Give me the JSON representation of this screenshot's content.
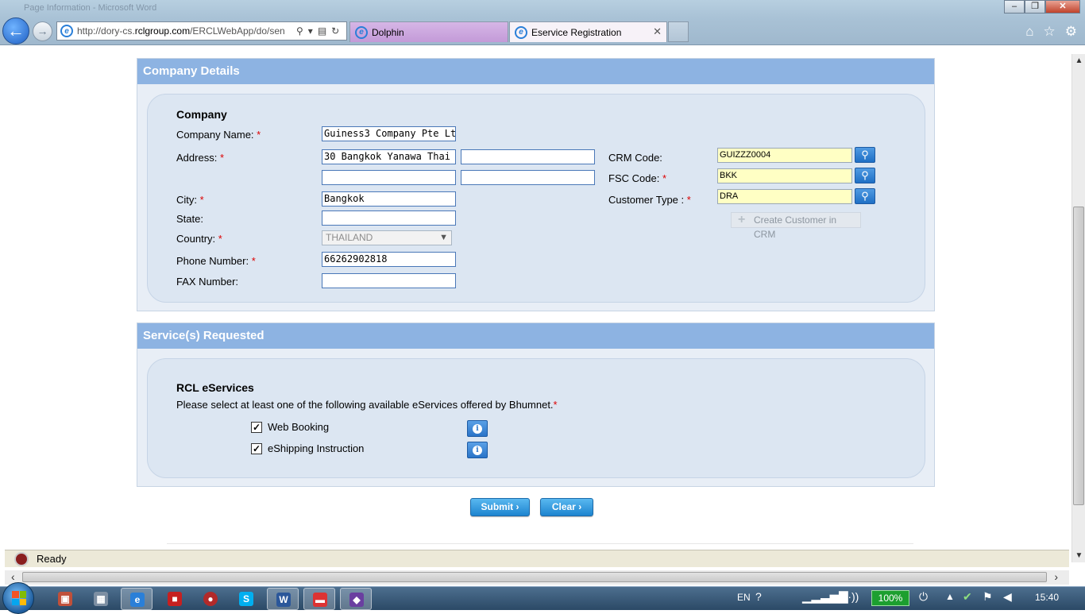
{
  "browser": {
    "window_title": "Page Information - Microsoft Word",
    "url_prefix": "http://dory-cs.",
    "url_domain": "rclgroup.com",
    "url_rest": "/ERCLWebApp/do/sen",
    "tabs": [
      {
        "label": "Dolphin"
      },
      {
        "label": "Eservice Registration"
      }
    ],
    "status_text": "Ready"
  },
  "company_section": {
    "header": "Company Details",
    "group_title": "Company",
    "company_name_label": "Company Name:",
    "company_name_value": "Guiness3 Company Pte Lt",
    "address_label": "Address:",
    "address_line1": "30 Bangkok Yanawa Thai",
    "address_line2": "",
    "address_line3": "",
    "address_line4": "",
    "city_label": "City:",
    "city_value": "Bangkok",
    "state_label": "State:",
    "state_value": "",
    "country_label": "Country:",
    "country_value": "THAILAND",
    "phone_label": "Phone Number:",
    "phone_value": "66262902818",
    "fax_label": "FAX Number:",
    "fax_value": "",
    "crm_code_label": "CRM Code:",
    "crm_code_value": "GUIZZZ0004",
    "fsc_code_label": "FSC Code:",
    "fsc_code_value": "BKK",
    "customer_type_label": "Customer Type :",
    "customer_type_value": "DRA",
    "create_customer_label": "Create Customer in CRM",
    "required_mark": "*"
  },
  "services_section": {
    "header": "Service(s) Requested",
    "group_title": "RCL eServices",
    "instruction": "Please select at least one of the following available eServices offered by Bhumnet.",
    "required_mark": "*",
    "services": [
      {
        "label": "Web Booking",
        "checked": true
      },
      {
        "label": "eShipping Instruction",
        "checked": true
      }
    ]
  },
  "actions": {
    "submit_label": "Submit",
    "clear_label": "Clear"
  },
  "taskbar": {
    "language": "EN",
    "battery": "100%",
    "time": "15:40"
  },
  "colors": {
    "section_header": "#8db3e2",
    "panel_bg": "#dce6f2",
    "field_highlight": "#ffffc4",
    "button_blue": "#1d84cf",
    "required": "#dd0000"
  }
}
